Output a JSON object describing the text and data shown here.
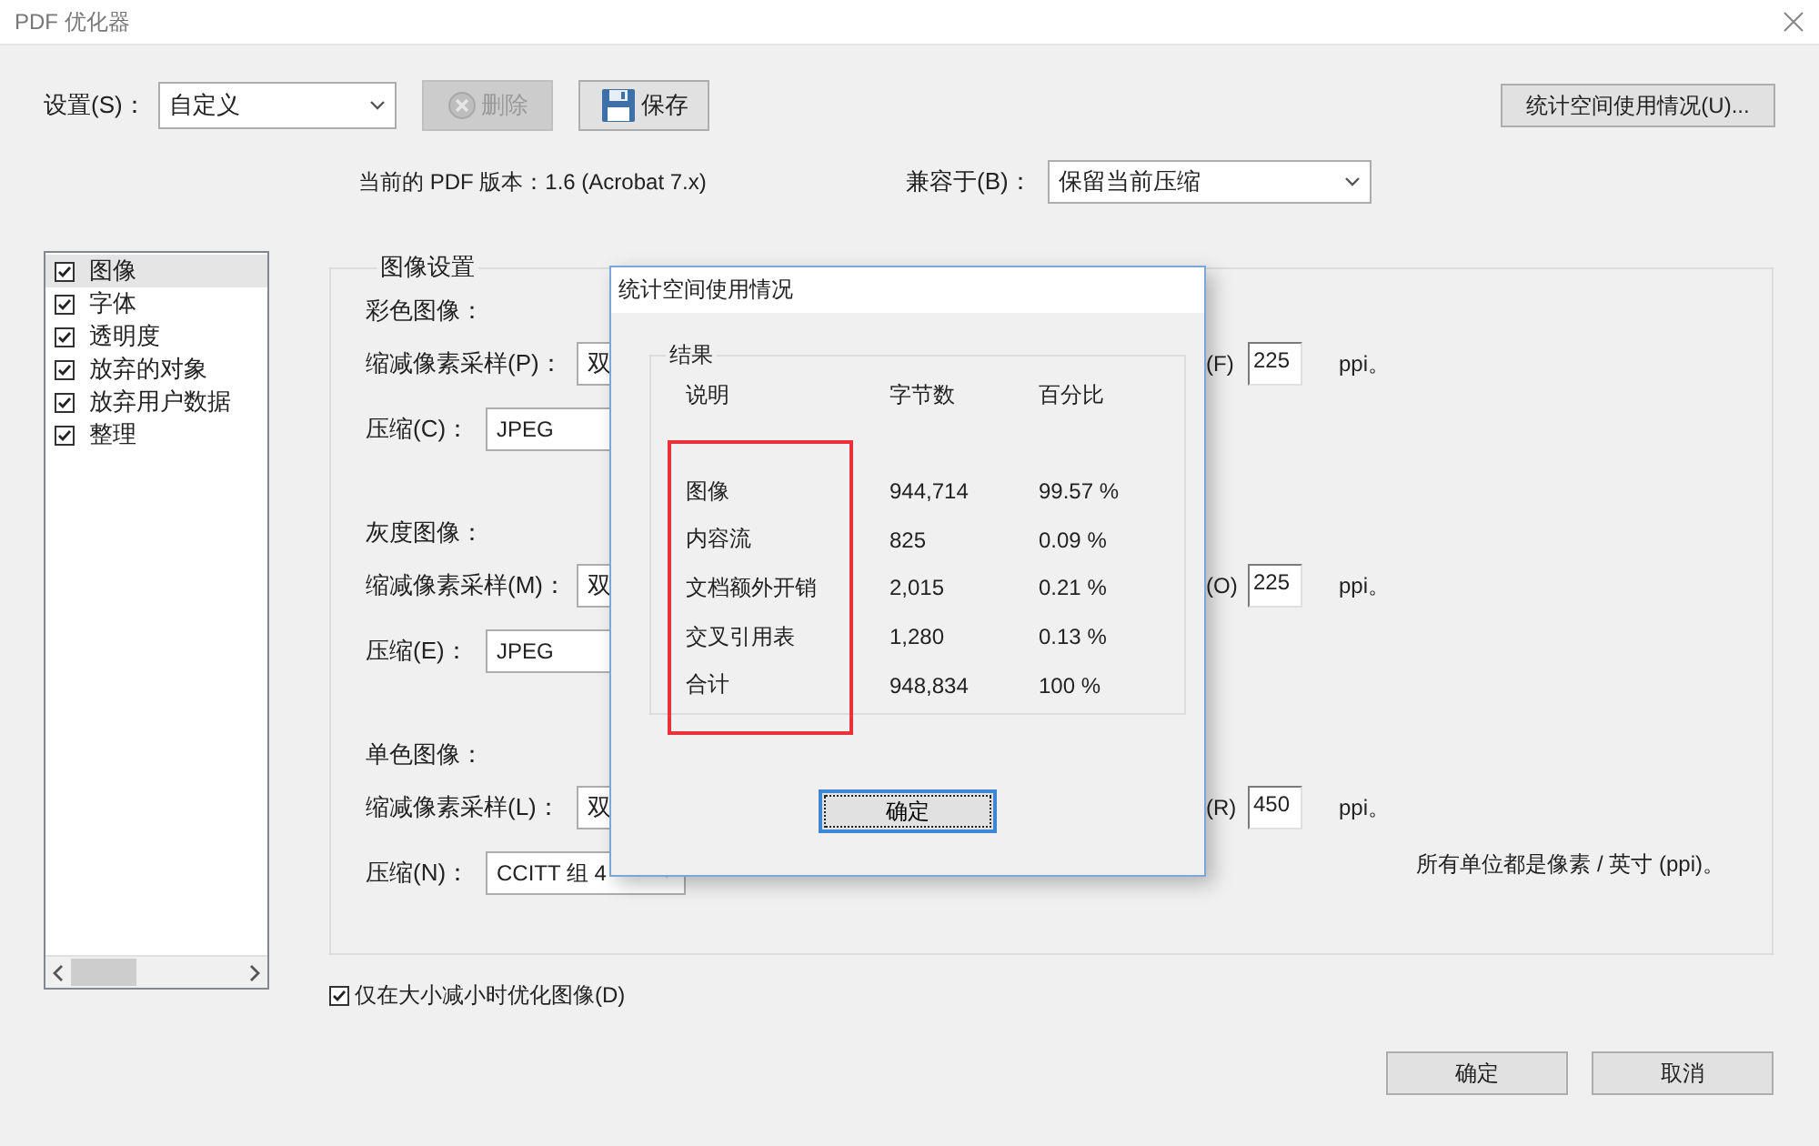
{
  "window": {
    "title": "PDF 优化器"
  },
  "settings": {
    "label": "设置(S)：",
    "value": "自定义"
  },
  "toolbar": [
    {
      "kind": "delete",
      "label": "删除",
      "disabled": true
    },
    {
      "kind": "save",
      "label": "保存",
      "disabled": false
    }
  ],
  "audit_button": "统计空间使用情况(U)...",
  "version_text": "当前的 PDF 版本：1.6 (Acrobat 7.x)",
  "compat": {
    "label": "兼容于(B)：",
    "value": "保留当前压缩"
  },
  "sidebar": {
    "items": [
      {
        "label": "图像",
        "checked": true,
        "selected": true
      },
      {
        "label": "字体",
        "checked": true,
        "selected": false
      },
      {
        "label": "透明度",
        "checked": true,
        "selected": false
      },
      {
        "label": "放弃的对象",
        "checked": true,
        "selected": false
      },
      {
        "label": "放弃用户数据",
        "checked": true,
        "selected": false
      },
      {
        "label": "整理",
        "checked": true,
        "selected": false
      }
    ]
  },
  "image_settings": {
    "title": "图像设置",
    "sections": [
      {
        "heading": "彩色图像：",
        "downsample": {
          "label": "缩减像素采样(P)：",
          "value": "双"
        },
        "resolution": {
          "label": "(F)",
          "value": "225",
          "unit": "ppi。"
        },
        "compression": {
          "label": "压缩(C)：",
          "value": "JPEG"
        }
      },
      {
        "heading": "灰度图像：",
        "downsample": {
          "label": "缩减像素采样(M)：",
          "value": "双"
        },
        "resolution": {
          "label": "(O)",
          "value": "225",
          "unit": "ppi。"
        },
        "compression": {
          "label": "压缩(E)：",
          "value": "JPEG"
        }
      },
      {
        "heading": "单色图像：",
        "downsample": {
          "label": "缩减像素采样(L)：",
          "value": "双"
        },
        "resolution": {
          "label": "(R)",
          "value": "450",
          "unit": "ppi。"
        },
        "compression": {
          "label": "压缩(N)：",
          "value": "CCITT 组 4"
        }
      }
    ],
    "footnote": "所有单位都是像素 / 英寸 (ppi)。"
  },
  "optimize_checkbox": {
    "label": "仅在大小减小时优化图像(D)",
    "checked": true
  },
  "buttons": [
    "确定",
    "取消"
  ],
  "dialog": {
    "title": "统计空间使用情况",
    "group": "结果",
    "columns": [
      "说明",
      "字节数",
      "百分比"
    ],
    "rows": [
      [
        "图像",
        "944,714",
        "99.57 %"
      ],
      [
        "内容流",
        "825",
        "0.09 %"
      ],
      [
        "文档额外开销",
        "2,015",
        "0.21 %"
      ],
      [
        "交叉引用表",
        "1,280",
        "0.13 %"
      ],
      [
        "合计",
        "948,834",
        "100 %"
      ]
    ],
    "button": "确定"
  }
}
